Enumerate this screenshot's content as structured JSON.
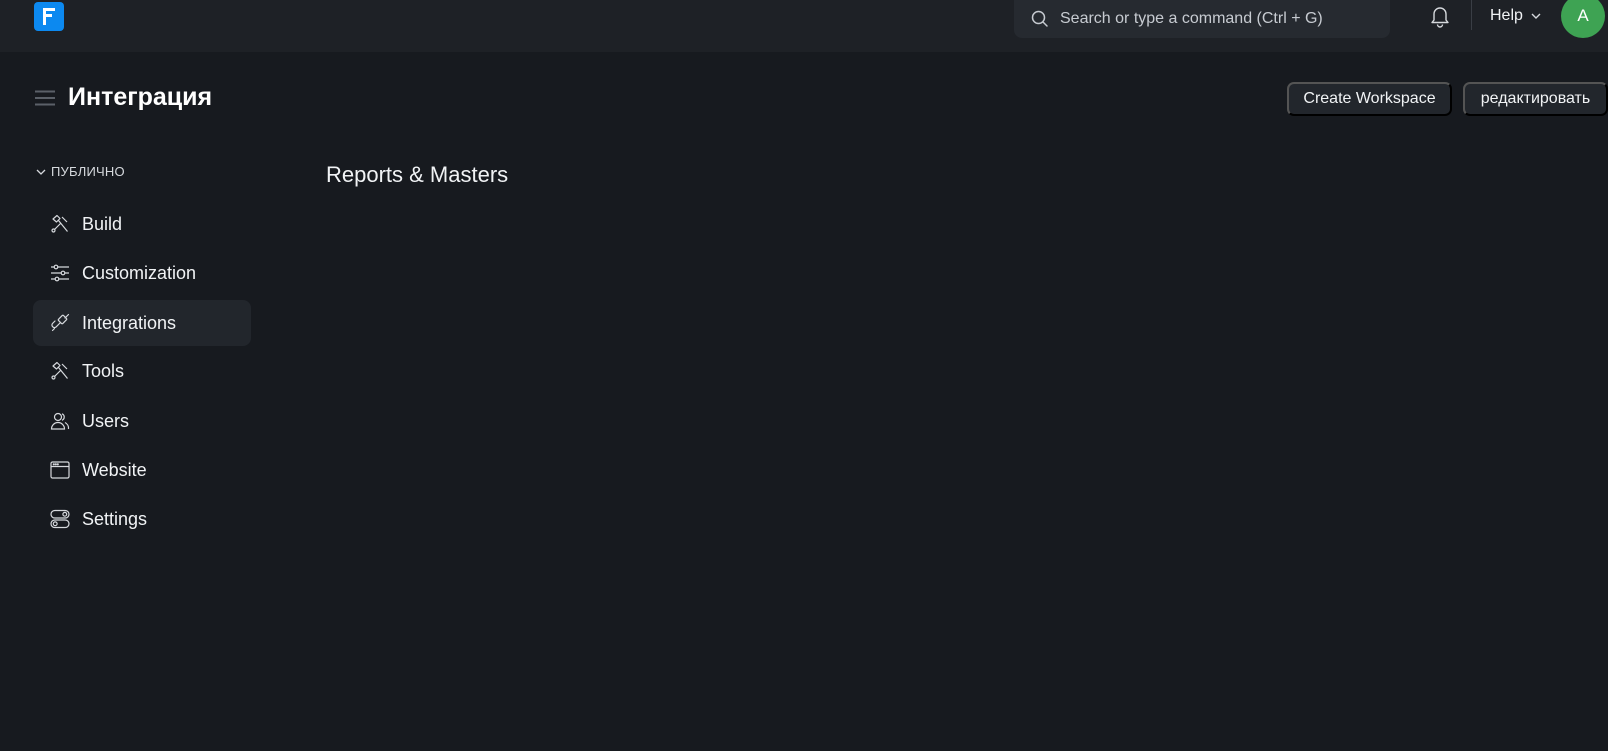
{
  "navbar": {
    "search_placeholder": "Search or type a command (Ctrl + G)",
    "help_label": "Help",
    "avatar_initial": "A",
    "colors": {
      "logo": "#0c89f0",
      "avatar": "#3ea353"
    }
  },
  "page": {
    "title": "Интеграция",
    "create_workspace_label": "Create Workspace",
    "edit_label": "редактировать"
  },
  "sidebar": {
    "section_label": "ПУБЛИЧНО",
    "items": [
      {
        "label": "Build",
        "icon": "hammer-icon",
        "active": false
      },
      {
        "label": "Customization",
        "icon": "sliders-icon",
        "active": false
      },
      {
        "label": "Integrations",
        "icon": "plug-icon",
        "active": true
      },
      {
        "label": "Tools",
        "icon": "tools-icon",
        "active": false
      },
      {
        "label": "Users",
        "icon": "users-icon",
        "active": false
      },
      {
        "label": "Website",
        "icon": "browser-window-icon",
        "active": false
      },
      {
        "label": "Settings",
        "icon": "toggles-icon",
        "active": false
      }
    ]
  },
  "main": {
    "section_title": "Reports & Masters"
  }
}
